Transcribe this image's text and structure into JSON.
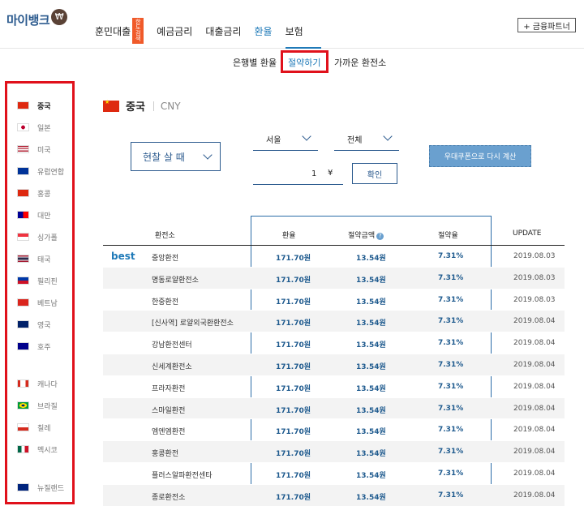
{
  "header": {
    "logo_text": "마이뱅크",
    "logo_badge": "₩",
    "nav": [
      {
        "label": "훈민대출",
        "badge": "한도 검색"
      },
      {
        "label": "예금금리"
      },
      {
        "label": "대출금리"
      },
      {
        "label": "환율",
        "active": true
      },
      {
        "label": "보험"
      }
    ],
    "partner_button": "+ 금융파트너"
  },
  "subtabs": [
    {
      "label": "은행별 환율"
    },
    {
      "label": "절약하기",
      "active": true
    },
    {
      "label": "가까운 환전소"
    }
  ],
  "sidebar": {
    "items": [
      {
        "label": "중국",
        "flag": "china",
        "active": true
      },
      {
        "label": "일본",
        "flag": "japan"
      },
      {
        "label": "미국",
        "flag": "usa"
      },
      {
        "label": "유럽연합",
        "flag": "eu"
      },
      {
        "label": "홍콩",
        "flag": "hongkong"
      },
      {
        "label": "대만",
        "flag": "taiwan"
      },
      {
        "label": "싱가폴",
        "flag": "singapore"
      },
      {
        "label": "태국",
        "flag": "thailand"
      },
      {
        "label": "필리핀",
        "flag": "philippines"
      },
      {
        "label": "베트남",
        "flag": "vietnam"
      },
      {
        "label": "영국",
        "flag": "uk"
      },
      {
        "label": "호주",
        "flag": "australia"
      },
      {
        "label": "캐나다",
        "flag": "canada"
      },
      {
        "label": "브라질",
        "flag": "brazil"
      },
      {
        "label": "칠레",
        "flag": "chile"
      },
      {
        "label": "멕시코",
        "flag": "mexico"
      },
      {
        "label": "뉴질랜드",
        "flag": "newzealand"
      }
    ]
  },
  "country": {
    "name": "중국",
    "code": "CNY"
  },
  "controls": {
    "type_select": "현찰 살 때",
    "region_select": "서울",
    "district_select": "전체",
    "amount": "1",
    "currency_symbol": "¥",
    "confirm_button": "확인",
    "coupon_button": "우대쿠폰으로 다시 계산"
  },
  "table": {
    "headers": {
      "name": "환전소",
      "rate": "환율",
      "saving": "절약금액",
      "pct": "절약율",
      "update": "UPDATE"
    },
    "best_label": "best",
    "rows": [
      {
        "name": "중앙환전",
        "rate": "171.70원",
        "saving": "13.54원",
        "pct": "7.31%",
        "date": "2019.08.03"
      },
      {
        "name": "명동로얄환전소",
        "rate": "171.70원",
        "saving": "13.54원",
        "pct": "7.31%",
        "date": "2019.08.03"
      },
      {
        "name": "한중환전",
        "rate": "171.70원",
        "saving": "13.54원",
        "pct": "7.31%",
        "date": "2019.08.03"
      },
      {
        "name": "[신사역] 로얄외국환환전소",
        "rate": "171.70원",
        "saving": "13.54원",
        "pct": "7.31%",
        "date": "2019.08.04"
      },
      {
        "name": "강남환전센터",
        "rate": "171.70원",
        "saving": "13.54원",
        "pct": "7.31%",
        "date": "2019.08.04"
      },
      {
        "name": "신세계환전소",
        "rate": "171.70원",
        "saving": "13.54원",
        "pct": "7.31%",
        "date": "2019.08.04"
      },
      {
        "name": "프라자환전",
        "rate": "171.70원",
        "saving": "13.54원",
        "pct": "7.31%",
        "date": "2019.08.04"
      },
      {
        "name": "스마일환전",
        "rate": "171.70원",
        "saving": "13.54원",
        "pct": "7.31%",
        "date": "2019.08.04"
      },
      {
        "name": "엠엔엠환전",
        "rate": "171.70원",
        "saving": "13.54원",
        "pct": "7.31%",
        "date": "2019.08.04"
      },
      {
        "name": "홍콩환전",
        "rate": "171.70원",
        "saving": "13.54원",
        "pct": "7.31%",
        "date": "2019.08.04"
      },
      {
        "name": "플러스알파환전센타",
        "rate": "171.70원",
        "saving": "13.54원",
        "pct": "7.31%",
        "date": "2019.08.04"
      },
      {
        "name": "종로환전소",
        "rate": "171.70원",
        "saving": "13.54원",
        "pct": "7.31%",
        "date": "2019.08.04"
      }
    ]
  }
}
